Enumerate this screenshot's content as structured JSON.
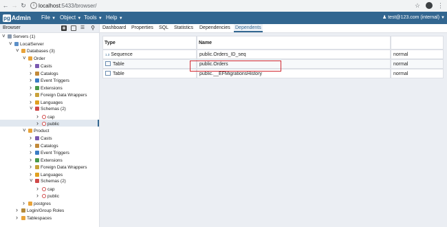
{
  "browser": {
    "url_host": "localhost",
    "url_rest": ":5433/browser/"
  },
  "app": {
    "logo_pg": "pg",
    "logo_admin": "Admin",
    "menus": [
      "File",
      "Object",
      "Tools",
      "Help"
    ],
    "user": "test@123.com (internal)"
  },
  "browser_panel": {
    "title": "Browser",
    "tree": [
      {
        "label": "Servers (1)",
        "level": 0,
        "expanded": true,
        "icon": "servers-icon"
      },
      {
        "label": "LocalServer",
        "level": 1,
        "expanded": true,
        "icon": "server-icon"
      },
      {
        "label": "Databases (3)",
        "level": 2,
        "expanded": true,
        "icon": "databases-icon"
      },
      {
        "label": "Order",
        "level": 3,
        "expanded": true,
        "icon": "database-icon"
      },
      {
        "label": "Casts",
        "level": 4,
        "expanded": false,
        "icon": "casts-icon"
      },
      {
        "label": "Catalogs",
        "level": 4,
        "expanded": false,
        "icon": "catalogs-icon"
      },
      {
        "label": "Event Triggers",
        "level": 4,
        "expanded": false,
        "icon": "event-triggers-icon"
      },
      {
        "label": "Extensions",
        "level": 4,
        "expanded": false,
        "icon": "extensions-icon"
      },
      {
        "label": "Foreign Data Wrappers",
        "level": 4,
        "expanded": false,
        "icon": "foreign-data-wrappers-icon"
      },
      {
        "label": "Languages",
        "level": 4,
        "expanded": false,
        "icon": "languages-icon"
      },
      {
        "label": "Schemas (2)",
        "level": 4,
        "expanded": true,
        "icon": "schemas-icon"
      },
      {
        "label": "cap",
        "level": 5,
        "expanded": false,
        "icon": "schema-icon"
      },
      {
        "label": "public",
        "level": 5,
        "expanded": false,
        "icon": "schema-icon",
        "selected": true
      },
      {
        "label": "Product",
        "level": 3,
        "expanded": true,
        "icon": "database-icon"
      },
      {
        "label": "Casts",
        "level": 4,
        "expanded": false,
        "icon": "casts-icon"
      },
      {
        "label": "Catalogs",
        "level": 4,
        "expanded": false,
        "icon": "catalogs-icon"
      },
      {
        "label": "Event Triggers",
        "level": 4,
        "expanded": false,
        "icon": "event-triggers-icon"
      },
      {
        "label": "Extensions",
        "level": 4,
        "expanded": false,
        "icon": "extensions-icon"
      },
      {
        "label": "Foreign Data Wrappers",
        "level": 4,
        "expanded": false,
        "icon": "foreign-data-wrappers-icon"
      },
      {
        "label": "Languages",
        "level": 4,
        "expanded": false,
        "icon": "languages-icon"
      },
      {
        "label": "Schemas (2)",
        "level": 4,
        "expanded": true,
        "icon": "schemas-icon"
      },
      {
        "label": "cap",
        "level": 5,
        "expanded": false,
        "icon": "schema-icon"
      },
      {
        "label": "public",
        "level": 5,
        "expanded": false,
        "icon": "schema-icon"
      },
      {
        "label": "postgres",
        "level": 3,
        "expanded": false,
        "icon": "database-icon"
      },
      {
        "label": "Login/Group Roles",
        "level": 2,
        "expanded": false,
        "icon": "roles-icon"
      },
      {
        "label": "Tablespaces",
        "level": 2,
        "expanded": false,
        "icon": "tablespaces-icon"
      }
    ]
  },
  "tabs": [
    "Dashboard",
    "Properties",
    "SQL",
    "Statistics",
    "Dependencies",
    "Dependents"
  ],
  "active_tab": "Dependents",
  "grid": {
    "columns": [
      "Type",
      "Name",
      ""
    ],
    "rows": [
      {
        "type_prefix": "1.3",
        "type": "Sequence",
        "name": "public.Orders_ID_seq",
        "restriction": "normal"
      },
      {
        "type_prefix": "",
        "type": "Table",
        "name": "public.Orders",
        "restriction": "normal",
        "highlighted": true
      },
      {
        "type_prefix": "",
        "type": "Table",
        "name": "public.__EFMigrationsHistory",
        "restriction": "normal"
      }
    ]
  },
  "colors": {
    "navbar": "#326690",
    "highlight_border": "#d0262e",
    "content_bg": "#ebeef3"
  }
}
